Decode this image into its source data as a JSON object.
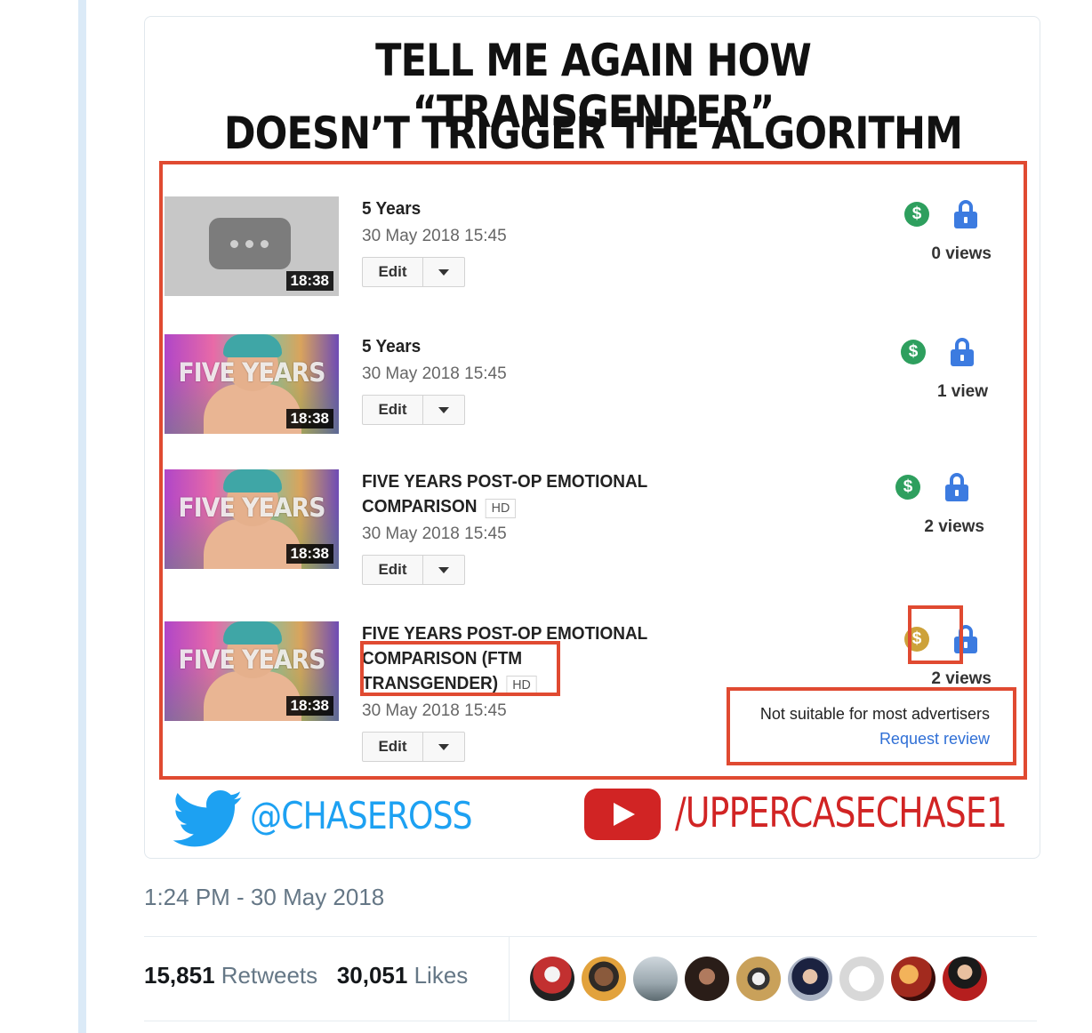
{
  "tweet_image": {
    "headline_line1": "TELL ME AGAIN HOW “TRANSGENDER”",
    "headline_line2": "DOESN’T TRIGGER THE ALGORITHM",
    "videos": [
      {
        "title": "5 Years",
        "hd": "",
        "date": "30 May 2018 15:45",
        "duration": "18:38",
        "views": "0 views",
        "edit_label": "Edit",
        "monetization": "green",
        "thumbnail": "placeholder"
      },
      {
        "title": "5 Years",
        "hd": "",
        "date": "30 May 2018 15:45",
        "duration": "18:38",
        "views": "1 view",
        "edit_label": "Edit",
        "monetization": "green",
        "thumbnail_text": "FIVE YEARS"
      },
      {
        "title_line1": "FIVE YEARS POST-OP EMOTIONAL",
        "title_line2": "COMPARISON",
        "hd": "HD",
        "date": "30 May 2018 15:45",
        "duration": "18:38",
        "views": "2 views",
        "edit_label": "Edit",
        "monetization": "green",
        "thumbnail_text": "FIVE YEARS"
      },
      {
        "title_line1": "FIVE YEARS POST-OP EMOTIONAL",
        "title_line2": "COMPARISON (FTM",
        "title_line3": "TRANSGENDER)",
        "hd": "HD",
        "date": "30 May 2018 15:45",
        "duration": "18:38",
        "views": "2 views",
        "edit_label": "Edit",
        "monetization": "yellow",
        "thumbnail_text": "FIVE YEARS",
        "ads_note": "Not suitable for most advertisers",
        "request_review": "Request review"
      }
    ],
    "money_symbol": "$",
    "twitter_handle": "@CHASEROSS",
    "youtube_channel": "/UPPERCASECHASE1"
  },
  "tweet": {
    "timestamp": "1:24 PM - 30 May 2018",
    "retweets_count": "15,851",
    "retweets_label": "Retweets",
    "likes_count": "30,051",
    "likes_label": "Likes"
  },
  "colors": {
    "annotation_red": "#e04a31",
    "monetized_green": "#2e9f5e",
    "limited_yellow": "#cda23a",
    "lock_blue": "#3c7be0",
    "twitter_blue": "#1da1f2",
    "youtube_red": "#d12424"
  }
}
